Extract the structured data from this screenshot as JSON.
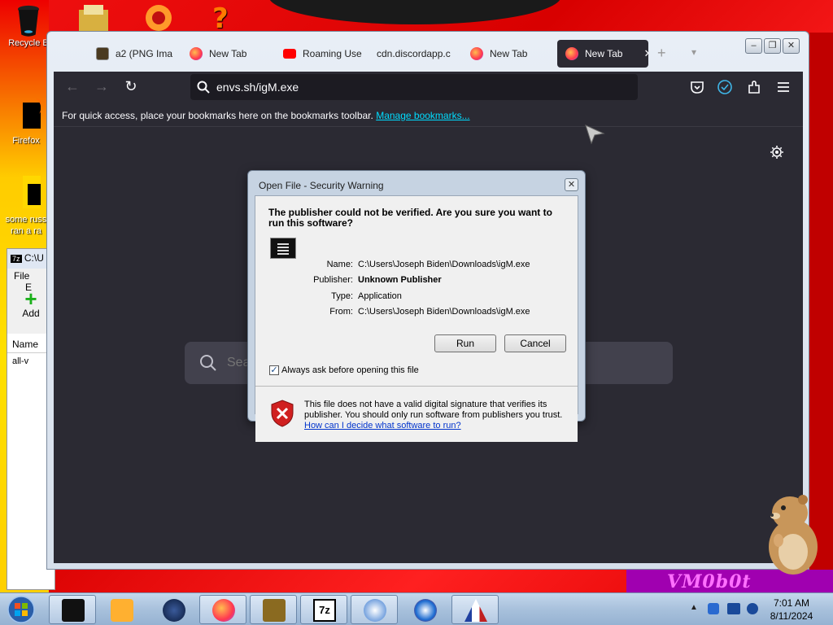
{
  "desktop": {
    "icons": [
      {
        "label": "Recycle B",
        "name": "recycle-bin"
      },
      {
        "label": "Firefox",
        "name": "firefox-shortcut"
      },
      {
        "label": "some russ\nran a ra",
        "name": "russ-shortcut"
      }
    ],
    "sevenzip": {
      "title": "C:\\U",
      "menu_file": "File",
      "menu_edit": "E",
      "add_label": "Add",
      "col_name": "Name",
      "row1": "all-v"
    },
    "wallpaper_text": "VM0b0t"
  },
  "browser": {
    "tabs": [
      {
        "label": "a2 (PNG Ima",
        "icon": "image-icon"
      },
      {
        "label": "New Tab",
        "icon": "firefox-icon"
      },
      {
        "label": "Roaming Use",
        "icon": "youtube-icon"
      },
      {
        "label": "cdn.discordapp.c",
        "icon": "none"
      },
      {
        "label": "New Tab",
        "icon": "firefox-icon"
      },
      {
        "label": "New Tab",
        "icon": "firefox-icon",
        "active": true
      }
    ],
    "url": "envs.sh/igM.exe",
    "bookmarks_bar_text": "For quick access, place your bookmarks here on the bookmarks toolbar.",
    "bookmarks_bar_link": "Manage bookmarks...",
    "newtab_search_placeholder": "Sea"
  },
  "dialog": {
    "title": "Open File - Security Warning",
    "heading": "The publisher could not be verified.  Are you sure you want to run this software?",
    "fields": {
      "name_label": "Name:",
      "name_value": "C:\\Users\\Joseph Biden\\Downloads\\igM.exe",
      "publisher_label": "Publisher:",
      "publisher_value": "Unknown Publisher",
      "type_label": "Type:",
      "type_value": "Application",
      "from_label": "From:",
      "from_value": "C:\\Users\\Joseph Biden\\Downloads\\igM.exe"
    },
    "run_label": "Run",
    "cancel_label": "Cancel",
    "checkbox_label": "Always ask before opening this file",
    "checkbox_checked": true,
    "warning_text": "This file does not have a valid digital signature that verifies its publisher.  You should only run software from publishers you trust.",
    "help_link": "How can I decide what software to run?"
  },
  "taskbar": {
    "time": "7:01 AM",
    "date": "8/11/2024",
    "items": [
      "terminal-app",
      "media-player-app",
      "globe-app",
      "firefox-app",
      "bonzi-app",
      "sevenzip-app",
      "shield-app",
      "browser-app",
      "arch-app"
    ]
  },
  "colors": {
    "accent_link": "#00ddff",
    "firefox_toolbar": "#2b2a33",
    "dialog_frame": "#c6d3e2",
    "wallpaper_red": "#e00000"
  }
}
